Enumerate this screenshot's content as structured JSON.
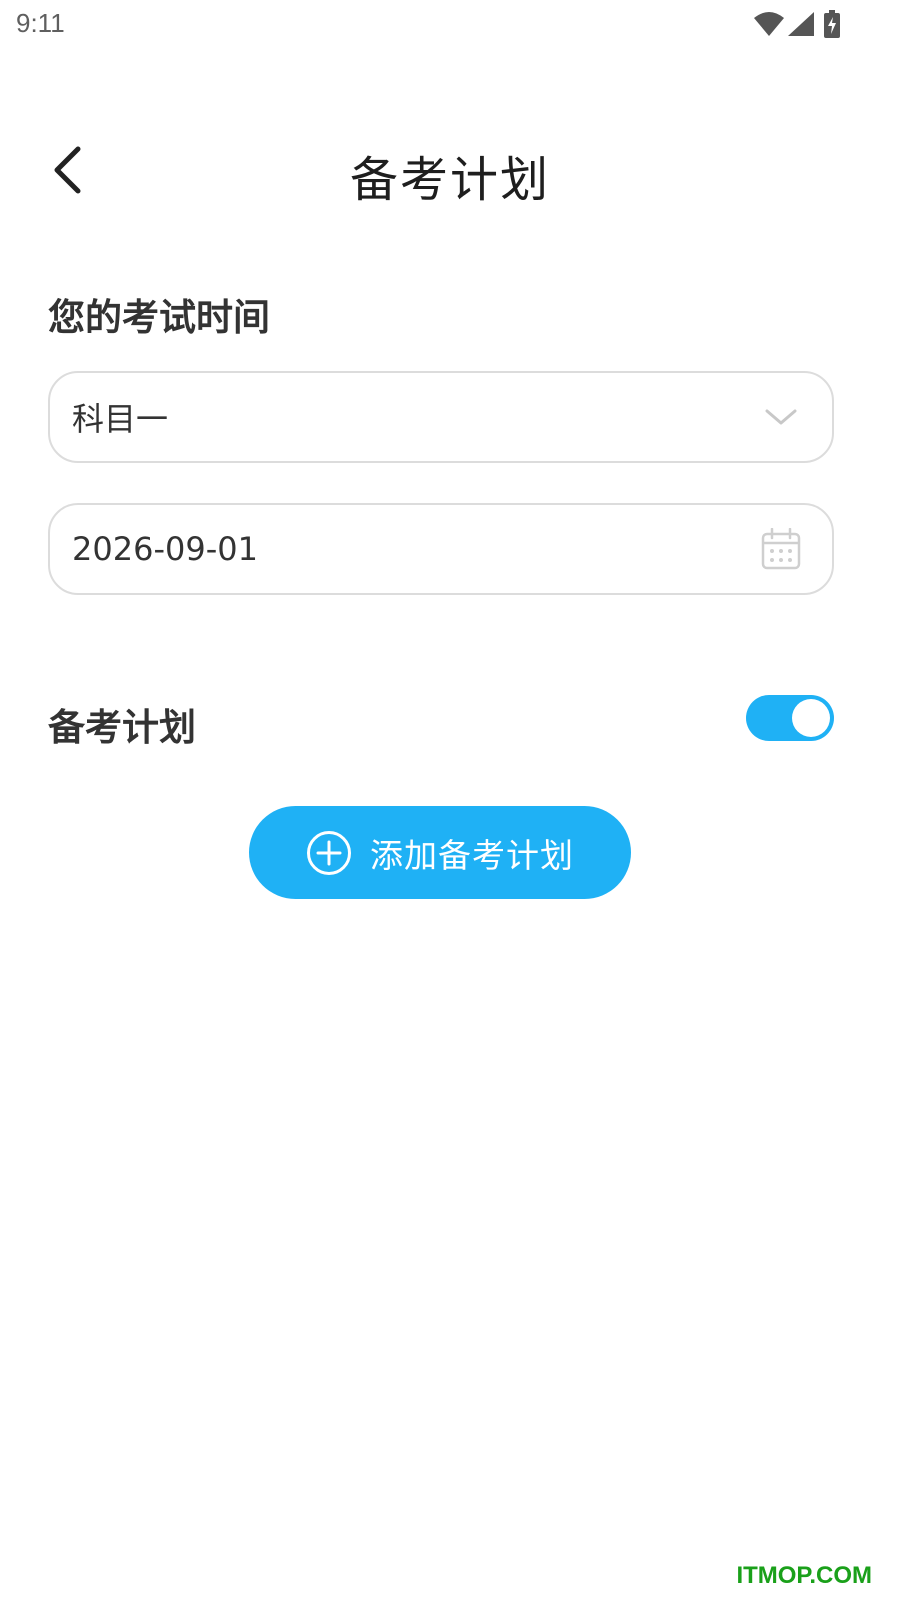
{
  "status_bar": {
    "time": "9:11"
  },
  "header": {
    "back_icon": "chevron-left-icon",
    "title": "备考计划"
  },
  "exam_time": {
    "section_title": "您的考试时间",
    "subject": {
      "value": "科目一",
      "icon": "chevron-down-icon"
    },
    "date": {
      "value": "2026-09-01",
      "icon": "calendar-icon"
    }
  },
  "study_plan": {
    "section_title": "备考计划",
    "toggle_on": true,
    "add_button_label": "添加备考计划",
    "add_button_icon": "plus-circle-icon"
  },
  "watermark": "ITMOP.COM",
  "colors": {
    "accent": "#1fb1f5",
    "border": "#dcdcdc",
    "watermark": "#1aa01a"
  }
}
